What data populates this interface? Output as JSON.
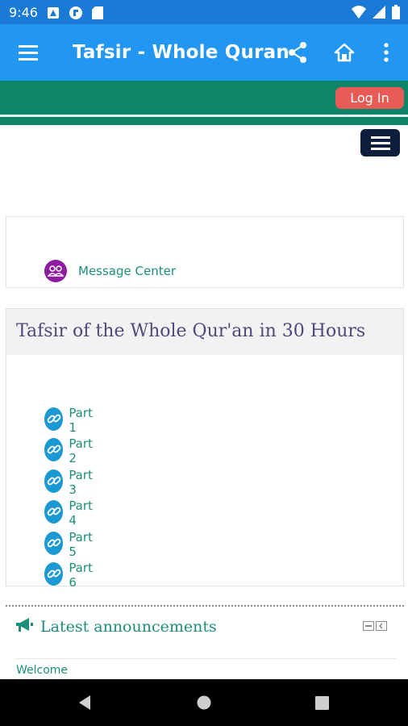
{
  "status": {
    "time": "9:46"
  },
  "appbar": {
    "title": "Tafsir - Whole Quran",
    "icons": [
      "menu-icon",
      "share-icon",
      "home-icon",
      "more-vert-icon"
    ]
  },
  "header": {
    "login_label": "Log In"
  },
  "message_center": {
    "label": "Message Center"
  },
  "tafsir": {
    "title": "Tafsir of the Whole Qur'an in 30 Hours",
    "parts": [
      "Part 1",
      "Part 2",
      "Part 3",
      "Part 4",
      "Part 5",
      "Part 6"
    ]
  },
  "announcements": {
    "title": "Latest announcements",
    "items": [
      "Welcome"
    ]
  },
  "colors": {
    "appbar": "#2196f3",
    "statusbar": "#1a7ad6",
    "teal": "#0e8568",
    "login": "#e75a55",
    "link": "#1b8f78",
    "part_icon": "#1a99d3",
    "message_icon": "#8e1c9e",
    "title": "#4e4a7a"
  }
}
